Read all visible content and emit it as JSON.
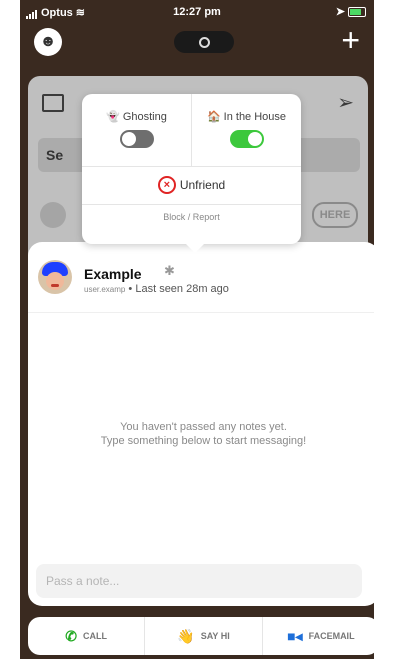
{
  "status_bar": {
    "carrier": "Optus",
    "time": "12:27 pm"
  },
  "background_card": {
    "search_prefix": "Se",
    "here_badge": "HERE"
  },
  "popover": {
    "ghosting": {
      "label": "Ghosting",
      "state": "off"
    },
    "in_the_house": {
      "label": "In the House",
      "state": "on"
    },
    "unfriend_label": "Unfriend",
    "block_report_label": "Block / Report"
  },
  "chat": {
    "contact_name": "Example",
    "username": "user.examp",
    "separator": "•",
    "last_seen": "Last seen 28m ago",
    "empty_line1": "You haven't passed any notes yet.",
    "empty_line2": "Type something below to start messaging!",
    "input_placeholder": "Pass a note..."
  },
  "bottom_bar": {
    "call_label": "CALL",
    "say_hi_label": "SAY HI",
    "facemail_label": "FACEMAIL"
  },
  "colors": {
    "toggle_on": "#3cc83c",
    "toggle_off": "#6e6e6e",
    "unfriend_red": "#e02424",
    "call_green": "#22aa22",
    "facemail_blue": "#1e6fd9"
  }
}
